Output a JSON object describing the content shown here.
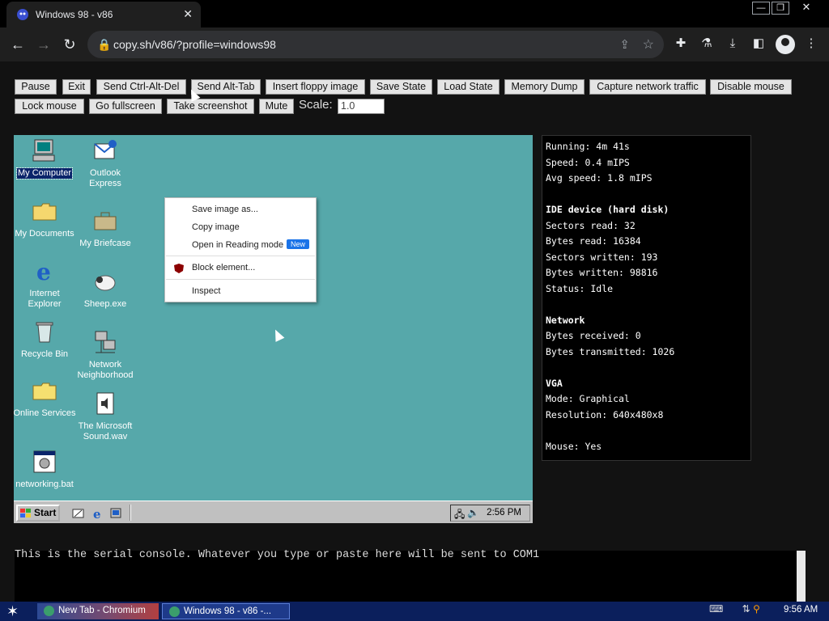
{
  "browser": {
    "tab_title": "Windows 98 - v86",
    "url": "copy.sh/v86/?profile=windows98"
  },
  "emulator_controls": {
    "buttons": [
      "Pause",
      "Exit",
      "Send Ctrl-Alt-Del",
      "Send Alt-Tab",
      "Insert floppy image",
      "Save State",
      "Load State",
      "Memory Dump",
      "Capture network traffic",
      "Disable mouse",
      "Lock mouse",
      "Go fullscreen",
      "Take screenshot",
      "Mute"
    ],
    "scale_label": "Scale:",
    "scale_value": "1.0"
  },
  "win98": {
    "desktop_icons": [
      "My Computer",
      "Outlook Express",
      "My Documents",
      "My Briefcase",
      "Internet Explorer",
      "Sheep.exe",
      "Recycle Bin",
      "Network Neighborhood",
      "Online Services",
      "The Microsoft Sound.wav",
      "networking.bat"
    ],
    "start_label": "Start",
    "clock": "2:56 PM"
  },
  "context_menu": {
    "items": [
      "Save image as...",
      "Copy image",
      "Open in Reading mode",
      "Block element...",
      "Inspect"
    ],
    "new_badge": "New"
  },
  "stats": {
    "running": "Running: 4m 41s",
    "speed": "Speed: 0.4 mIPS",
    "avg_speed": "Avg speed: 1.8 mIPS",
    "ide_header": "IDE device (hard disk)",
    "sectors_read": "Sectors read: 32",
    "bytes_read": "Bytes read: 16384",
    "sectors_written": "Sectors written: 193",
    "bytes_written": "Bytes written: 98816",
    "status": "Status: Idle",
    "network_header": "Network",
    "bytes_received": "Bytes received: 0",
    "bytes_transmitted": "Bytes transmitted: 1026",
    "vga_header": "VGA",
    "mode": "Mode: Graphical",
    "resolution": "Resolution: 640x480x8",
    "mouse": "Mouse: Yes"
  },
  "serial_console": {
    "text": "This is the serial console. Whatever you type or paste here will be sent to COM1"
  },
  "os_taskbar": {
    "task1": "New Tab - Chromium",
    "task2": "Windows 98 - v86 -...",
    "clock": "9:56 AM"
  }
}
